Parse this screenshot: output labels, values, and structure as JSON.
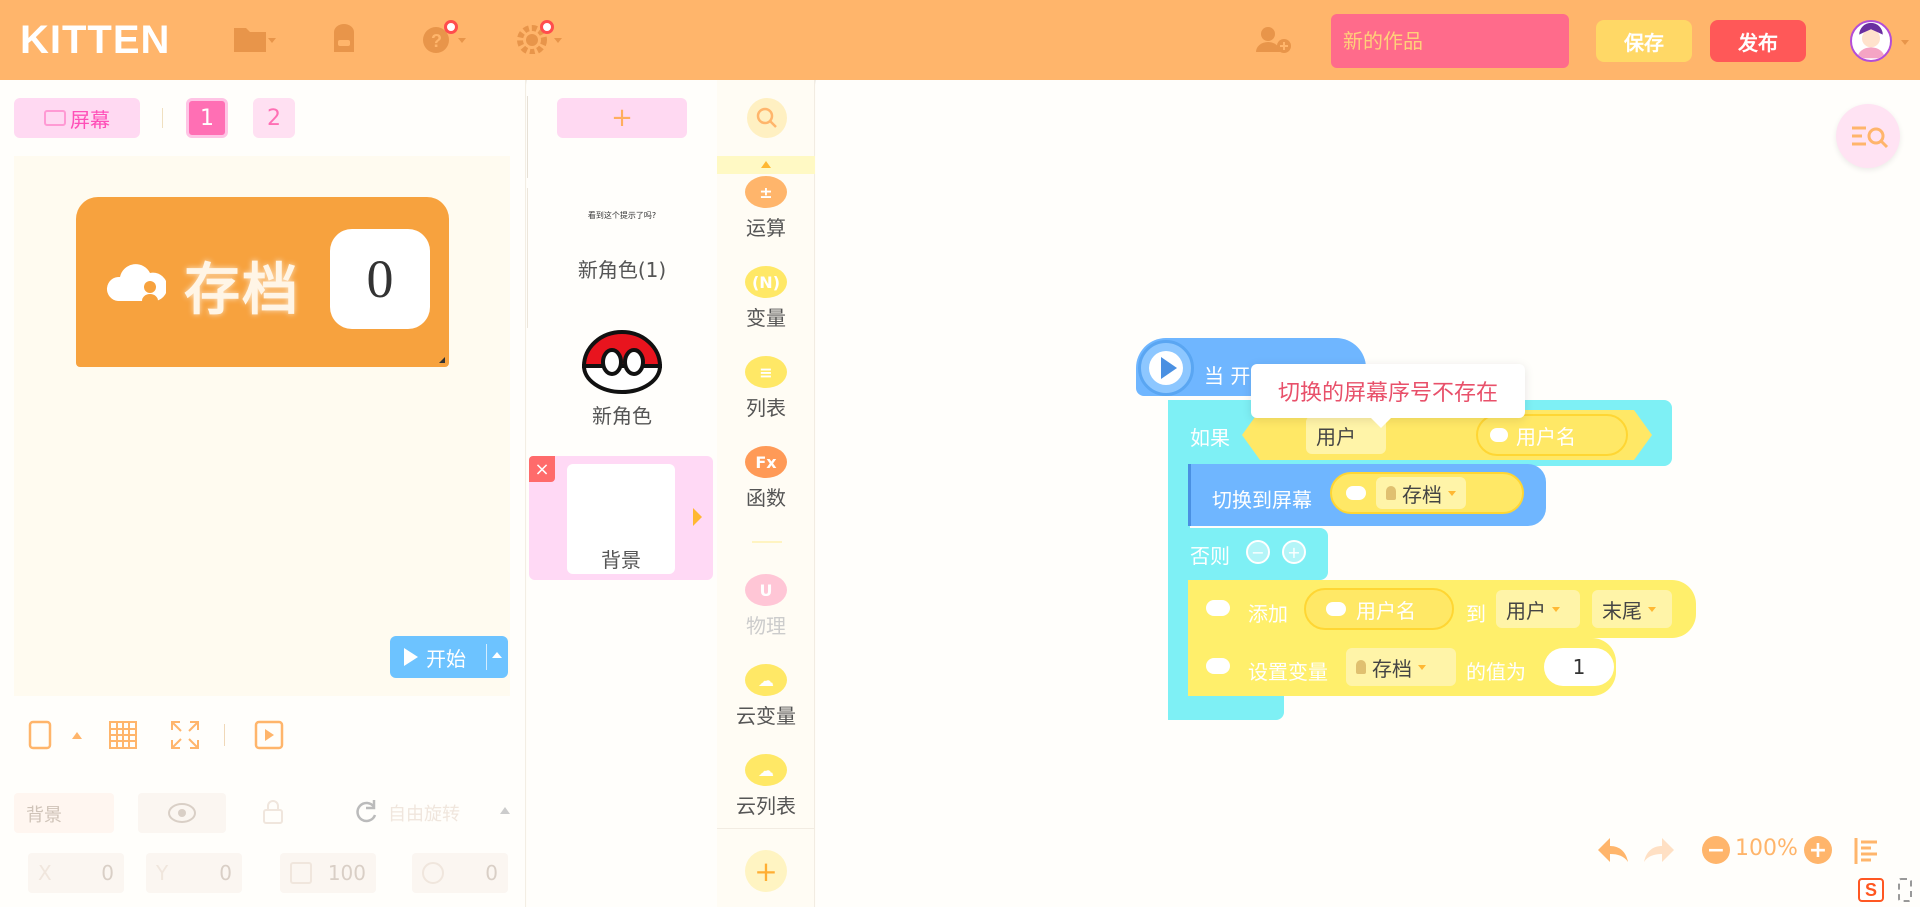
{
  "app": {
    "logo": "KITTEN",
    "title_placeholder": "新的作品",
    "save_label": "保存",
    "publish_label": "发布"
  },
  "stage": {
    "screen_label": "屏幕",
    "screen_tabs": [
      "1",
      "2"
    ],
    "widget_label": "存档",
    "widget_value": "0",
    "start_label": "开始"
  },
  "properties": {
    "name_placeholder": "背景",
    "rotation_label": "自由旋转",
    "x_label": "X",
    "x_value": "0",
    "y_label": "Y",
    "y_value": "0",
    "size_value": "100",
    "angle_value": "0"
  },
  "sprites": {
    "add_label": "+",
    "items": [
      {
        "name": "新角色(1)",
        "thumb_text": "看到这个提示了吗?"
      },
      {
        "name": "新角色"
      }
    ],
    "background_label": "背景",
    "delete_label": "×"
  },
  "categories": [
    {
      "label": "运算",
      "icon": "operator-icon",
      "color": "#ffb56b",
      "glyph": "±"
    },
    {
      "label": "变量",
      "icon": "variable-icon",
      "color": "#ffe866",
      "glyph": "(N)"
    },
    {
      "label": "列表",
      "icon": "list-icon",
      "color": "#ffe866",
      "glyph": "≡"
    },
    {
      "label": "函数",
      "icon": "function-icon",
      "color": "#ff9a57",
      "glyph": "Fx"
    },
    {
      "label": "物理",
      "icon": "physics-icon",
      "color": "#ffc6d6",
      "glyph": "U"
    },
    {
      "label": "云变量",
      "icon": "cloud-variable-icon",
      "color": "#ffe866",
      "glyph": "☁"
    },
    {
      "label": "云列表",
      "icon": "cloud-list-icon",
      "color": "#ffe866",
      "glyph": "☁"
    }
  ],
  "canvas": {
    "hat_label": "当 开",
    "if_label": "如果",
    "cond_left": "用户",
    "cond_right": "用户名",
    "switch_label": "切换到屏幕",
    "switch_value": "存档",
    "else_label": "否则",
    "add_label": "添加",
    "add_value": "用户名",
    "to_label": "到",
    "list_value": "用户",
    "position_value": "末尾",
    "set_label": "设置变量",
    "set_var": "存档",
    "set_value_label": "的值为",
    "set_value": "1",
    "tooltip": "切换的屏幕序号不存在",
    "zoom": "100%"
  },
  "colors": {
    "topbar": "#ffb56b",
    "publish": "#ff5858",
    "save": "#ffd866",
    "title_input": "#ff6b8b"
  }
}
